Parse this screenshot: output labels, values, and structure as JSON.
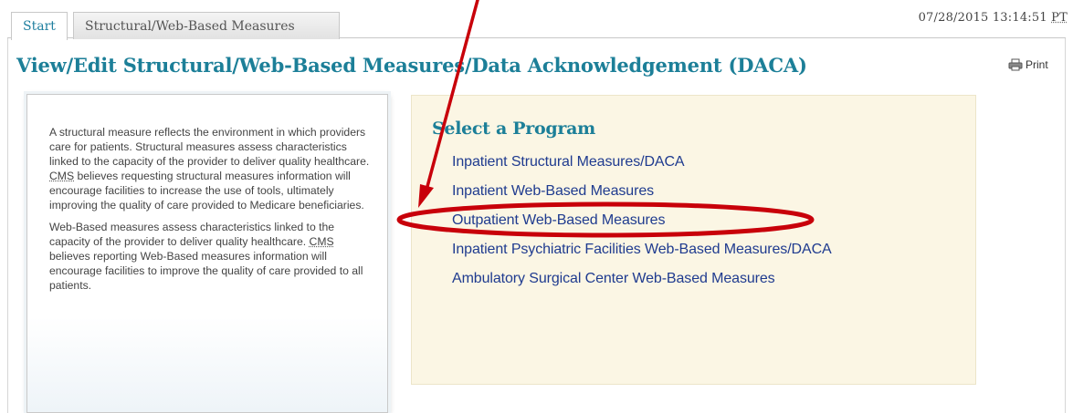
{
  "tabs": [
    {
      "label": "Start",
      "active": true
    },
    {
      "label": "Structural/Web-Based Measures",
      "active": false
    }
  ],
  "timestamp": {
    "datetime": "07/28/2015 13:14:51",
    "timezone": "PT"
  },
  "page_title": "View/Edit Structural/Web-Based Measures/Data Acknowledgement (DACA)",
  "print_label": "Print",
  "description": {
    "paragraph1": {
      "before": "A structural measure reflects the environment in which providers care for patients. Structural measures assess characteristics linked to the capacity of the provider to deliver quality healthcare. ",
      "abbr": "CMS",
      "after": " believes requesting structural measures information will encourage facilities to increase the use of tools, ultimately improving the quality of care provided to Medicare beneficiaries."
    },
    "paragraph2": {
      "before": "Web-Based measures assess characteristics linked to the capacity of the provider to deliver quality healthcare. ",
      "abbr": "CMS",
      "after": " believes reporting Web-Based measures information will encourage facilities to improve the quality of care provided to all patients."
    }
  },
  "program_select": {
    "heading": "Select a Program",
    "programs": [
      {
        "label": "Inpatient Structural Measures/DACA"
      },
      {
        "label": "Inpatient Web-Based Measures"
      },
      {
        "label": "Outpatient Web-Based Measures",
        "highlighted": true
      },
      {
        "label": "Inpatient Psychiatric Facilities Web-Based Measures/DACA"
      },
      {
        "label": "Ambulatory Surgical Center Web-Based Measures"
      }
    ]
  },
  "colors": {
    "accent_teal": "#1c7f98",
    "link_blue": "#1f3b8f",
    "program_box_bg": "#fbf6e4",
    "annotation_red": "#c8000a"
  },
  "icons": {
    "print": "printer-icon",
    "annotation_arrow": "arrow-annotation",
    "annotation_ellipse": "highlight-ellipse"
  }
}
